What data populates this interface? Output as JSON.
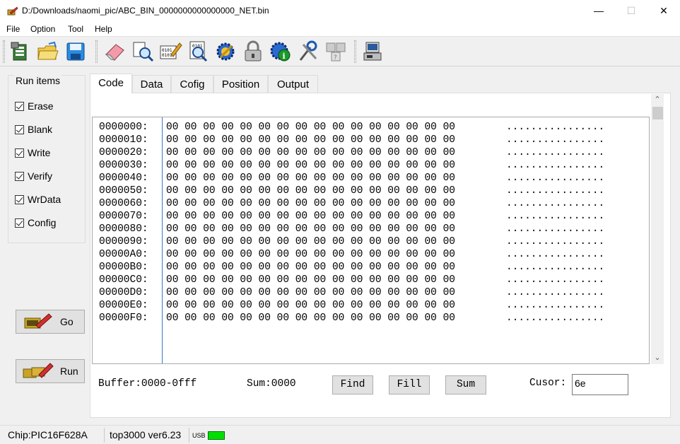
{
  "window": {
    "title": "D:/Downloads/naomi_pic/ABC_BIN_0000000000000000_NET.bin",
    "minimize": "—",
    "maximize": "☐",
    "close": "✕"
  },
  "menu": [
    "File",
    "Option",
    "Tool",
    "Help"
  ],
  "toolbar": {
    "buttons": [
      "open-chip-icon",
      "open-file-icon",
      "save-icon",
      "erase-icon",
      "blank-check-icon",
      "write-icon",
      "verify-icon",
      "config-icon",
      "lock-icon",
      "info-icon",
      "settings-icon",
      "chip-id-icon",
      "programmer-icon"
    ]
  },
  "run_items": {
    "title": "Run items",
    "items": [
      {
        "label": "Erase",
        "checked": true
      },
      {
        "label": "Blank",
        "checked": true
      },
      {
        "label": "Write",
        "checked": true
      },
      {
        "label": "Verify",
        "checked": true
      },
      {
        "label": "WrData",
        "checked": true
      },
      {
        "label": "Config",
        "checked": true
      }
    ]
  },
  "buttons": {
    "go": "Go",
    "run": "Run"
  },
  "tabs": [
    {
      "label": "Code",
      "active": true
    },
    {
      "label": "Data",
      "active": false
    },
    {
      "label": "Cofig",
      "active": false
    },
    {
      "label": "Position",
      "active": false
    },
    {
      "label": "Output",
      "active": false
    }
  ],
  "hex": {
    "rows": [
      {
        "addr": "0000000:",
        "bytes": "00 00 00 00 00 00 00 00 00 00 00 00 00 00 00 00",
        "ascii": "................"
      },
      {
        "addr": "0000010:",
        "bytes": "00 00 00 00 00 00 00 00 00 00 00 00 00 00 00 00",
        "ascii": "................"
      },
      {
        "addr": "0000020:",
        "bytes": "00 00 00 00 00 00 00 00 00 00 00 00 00 00 00 00",
        "ascii": "................"
      },
      {
        "addr": "0000030:",
        "bytes": "00 00 00 00 00 00 00 00 00 00 00 00 00 00 00 00",
        "ascii": "................"
      },
      {
        "addr": "0000040:",
        "bytes": "00 00 00 00 00 00 00 00 00 00 00 00 00 00 00 00",
        "ascii": "................"
      },
      {
        "addr": "0000050:",
        "bytes": "00 00 00 00 00 00 00 00 00 00 00 00 00 00 00 00",
        "ascii": "................"
      },
      {
        "addr": "0000060:",
        "bytes": "00 00 00 00 00 00 00 00 00 00 00 00 00 00 00 00",
        "ascii": "................"
      },
      {
        "addr": "0000070:",
        "bytes": "00 00 00 00 00 00 00 00 00 00 00 00 00 00 00 00",
        "ascii": "................"
      },
      {
        "addr": "0000080:",
        "bytes": "00 00 00 00 00 00 00 00 00 00 00 00 00 00 00 00",
        "ascii": "................"
      },
      {
        "addr": "0000090:",
        "bytes": "00 00 00 00 00 00 00 00 00 00 00 00 00 00 00 00",
        "ascii": "................"
      },
      {
        "addr": "00000A0:",
        "bytes": "00 00 00 00 00 00 00 00 00 00 00 00 00 00 00 00",
        "ascii": "................"
      },
      {
        "addr": "00000B0:",
        "bytes": "00 00 00 00 00 00 00 00 00 00 00 00 00 00 00 00",
        "ascii": "................"
      },
      {
        "addr": "00000C0:",
        "bytes": "00 00 00 00 00 00 00 00 00 00 00 00 00 00 00 00",
        "ascii": "................"
      },
      {
        "addr": "00000D0:",
        "bytes": "00 00 00 00 00 00 00 00 00 00 00 00 00 00 00 00",
        "ascii": "................"
      },
      {
        "addr": "00000E0:",
        "bytes": "00 00 00 00 00 00 00 00 00 00 00 00 00 00 00 00",
        "ascii": "................"
      },
      {
        "addr": "00000F0:",
        "bytes": "00 00 00 00 00 00 00 00 00 00 00 00 00 00 00 00",
        "ascii": "................"
      }
    ]
  },
  "footer": {
    "buffer": "Buffer:0000-0fff",
    "sum": "Sum:0000",
    "find": "Find",
    "fill": "Fill",
    "sum_button": "Sum",
    "cursor_label": "Cusor:",
    "cursor_value": "6e"
  },
  "status": {
    "chip": "Chip:PIC16F628A",
    "programmer": "top3000 ver6.23",
    "usb_label": "USB",
    "usb_color": "#00e000"
  },
  "scroll": {
    "up": "▲",
    "down": "﹀"
  }
}
